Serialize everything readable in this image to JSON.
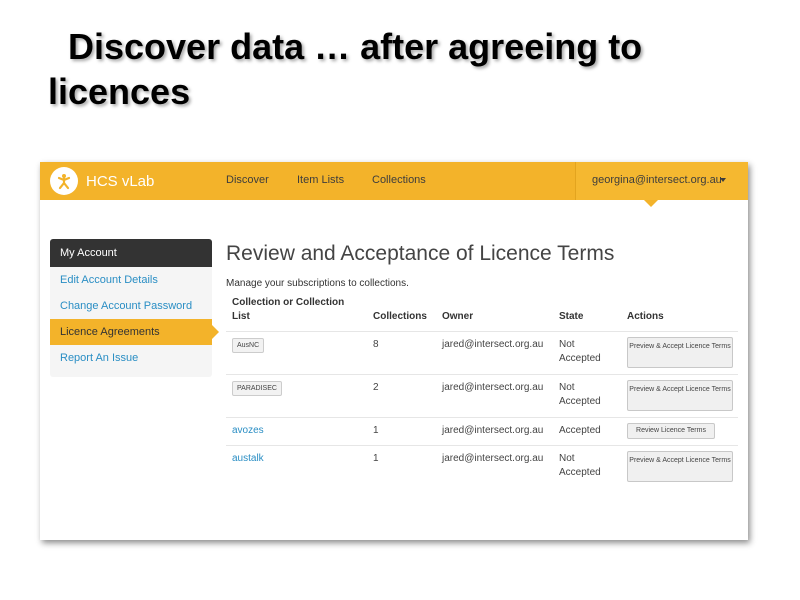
{
  "slide": {
    "title": "Discover data … after agreeing to licences"
  },
  "app": {
    "brand": "HCS vLab",
    "nav": [
      "Discover",
      "Item Lists",
      "Collections"
    ],
    "user": "georgina@intersect.org.au",
    "colors": {
      "navbar": "#f3b32a",
      "link": "#2a8ec4",
      "sidebar_header": "#333333"
    }
  },
  "sidebar": {
    "header": "My Account",
    "items": [
      {
        "label": "Edit Account Details",
        "active": false
      },
      {
        "label": "Change Account Password",
        "active": false
      },
      {
        "label": "Licence Agreements",
        "active": true
      },
      {
        "label": "Report An Issue",
        "active": false
      }
    ]
  },
  "main": {
    "heading": "Review and Acceptance of Licence Terms",
    "subheading": "Manage your subscriptions to collections.",
    "columns": [
      "Collection or Collection List",
      "Collections",
      "Owner",
      "State",
      "Actions"
    ],
    "rows": [
      {
        "name": "AusNC",
        "style": "tag",
        "collections": "8",
        "owner": "jared@intersect.org.au",
        "state": "Not Accepted",
        "action": "Preview & Accept Licence Terms"
      },
      {
        "name": "PARADISEC",
        "style": "tag",
        "collections": "2",
        "owner": "jared@intersect.org.au",
        "state": "Not Accepted",
        "action": "Preview & Accept Licence Terms"
      },
      {
        "name": "avozes",
        "style": "link",
        "collections": "1",
        "owner": "jared@intersect.org.au",
        "state": "Accepted",
        "action": "Review Licence Terms"
      },
      {
        "name": "austalk",
        "style": "link",
        "collections": "1",
        "owner": "jared@intersect.org.au",
        "state": "Not Accepted",
        "action": "Preview & Accept Licence Terms"
      }
    ]
  }
}
